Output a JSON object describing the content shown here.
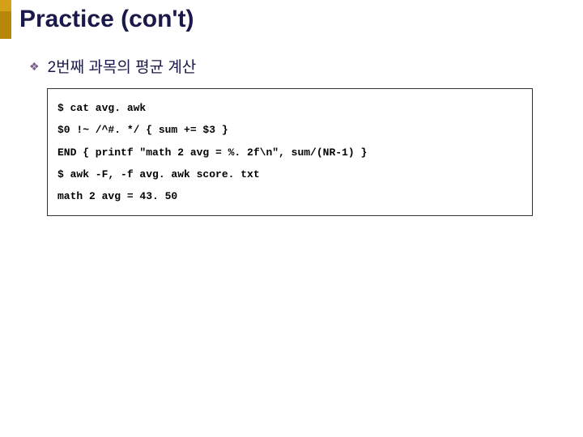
{
  "slide": {
    "title": "Practice (con't)",
    "subtitle": "2번째 과목의 평균 계산",
    "code": {
      "line1": "$ cat avg. awk",
      "line2": "$0 !~ /^#. */ { sum += $3 }",
      "line3": "END { printf \"math 2 avg = %. 2f\\n\", sum/(NR-1) }",
      "line4": "$ awk -F, -f avg. awk score. txt",
      "line5": "math 2 avg = 43. 50"
    }
  }
}
